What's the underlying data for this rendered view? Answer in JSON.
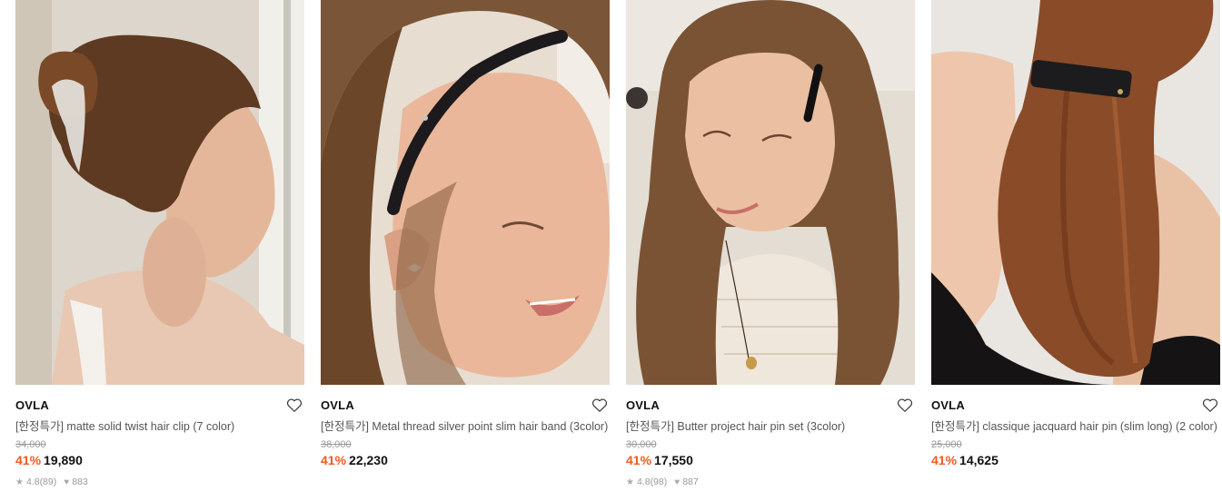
{
  "products": [
    {
      "brand": "OVLA",
      "name": "[한정특가] matte solid twist hair clip (7 color)",
      "original_price": "34,000",
      "discount": "41%",
      "price": "19,890",
      "rating": "4.8(89)",
      "likes": "883",
      "image_desc": "woman with hair in bun and white twist claw clip",
      "rating_icon": "star-icon",
      "likes_icon": "heart-filled-icon",
      "wishlist_icon": "heart-outline-icon"
    },
    {
      "brand": "OVLA",
      "name": "[한정특가] Metal thread silver point slim hair band (3color)",
      "original_price": "38,000",
      "discount": "41%",
      "price": "22,230",
      "rating": "",
      "likes": "",
      "image_desc": "smiling woman wearing black glitter hair band",
      "wishlist_icon": "heart-outline-icon"
    },
    {
      "brand": "OVLA",
      "name": "[한정특가] Butter project hair pin set (3color)",
      "original_price": "30,000",
      "discount": "41%",
      "price": "17,550",
      "rating": "4.8(98)",
      "likes": "887",
      "image_desc": "woman with wavy hair and black hair pin",
      "rating_icon": "star-icon",
      "likes_icon": "heart-filled-icon",
      "wishlist_icon": "heart-outline-icon"
    },
    {
      "brand": "OVLA",
      "name": "[한정특가] classique jacquard hair pin (slim long) (2 color)",
      "original_price": "25,000",
      "discount": "41%",
      "price": "14,625",
      "rating": "",
      "likes": "",
      "image_desc": "back view of auburn ponytail with black jacquard hair pin",
      "wishlist_icon": "heart-outline-icon"
    }
  ],
  "colors": {
    "discount": "#f05a22",
    "price": "#111111",
    "strike": "#9a9a9a",
    "name": "#555555"
  }
}
